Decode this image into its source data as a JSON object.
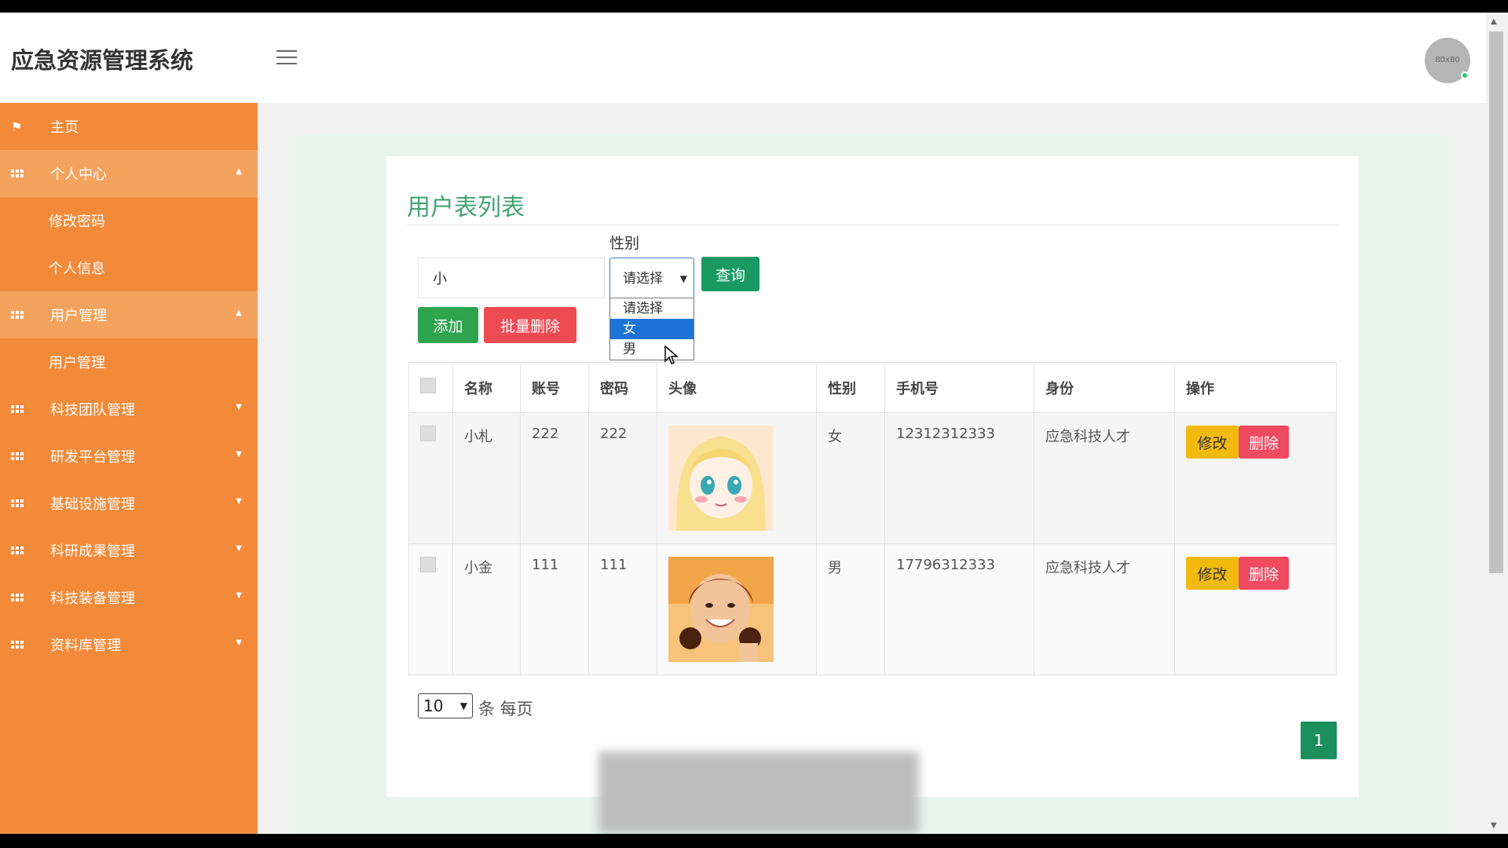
{
  "app": {
    "title": "应急资源管理系统",
    "avatar_text": "80x80"
  },
  "sidebar": {
    "home": "主页",
    "personal_center": "个人中心",
    "change_password": "修改密码",
    "personal_info": "个人信息",
    "user_management": "用户管理",
    "user_management_sub": "用户管理",
    "groups": [
      "科技团队管理",
      "研发平台管理",
      "基础设施管理",
      "科研成果管理",
      "科技装备管理",
      "资料库管理"
    ]
  },
  "main": {
    "title": "用户表列表",
    "search_value": "小",
    "gender_label": "性别",
    "gender_selected": "请选择",
    "search_button": "查询",
    "add_button": "添加",
    "batch_delete_button": "批量删除",
    "gender_options": [
      "请选择",
      "女",
      "男"
    ],
    "gender_highlighted": "女",
    "columns": [
      "名称",
      "账号",
      "密码",
      "头像",
      "性别",
      "手机号",
      "身份",
      "操作"
    ],
    "rows": [
      {
        "name": "小札",
        "account": "222",
        "password": "222",
        "gender": "女",
        "phone": "12312312333",
        "identity": "应急科技人才"
      },
      {
        "name": "小金",
        "account": "111",
        "password": "111",
        "gender": "男",
        "phone": "17796312333",
        "identity": "应急科技人才"
      }
    ],
    "edit_label": "修改",
    "delete_label": "删除",
    "page_size": "10",
    "per_page_text": "条 每页",
    "current_page": "1"
  },
  "colors": {
    "sidebar": "#f28a3a",
    "accent_green": "#43a473",
    "search_green": "#199a63",
    "danger": "#ee4a52",
    "warning": "#f2b90f"
  }
}
